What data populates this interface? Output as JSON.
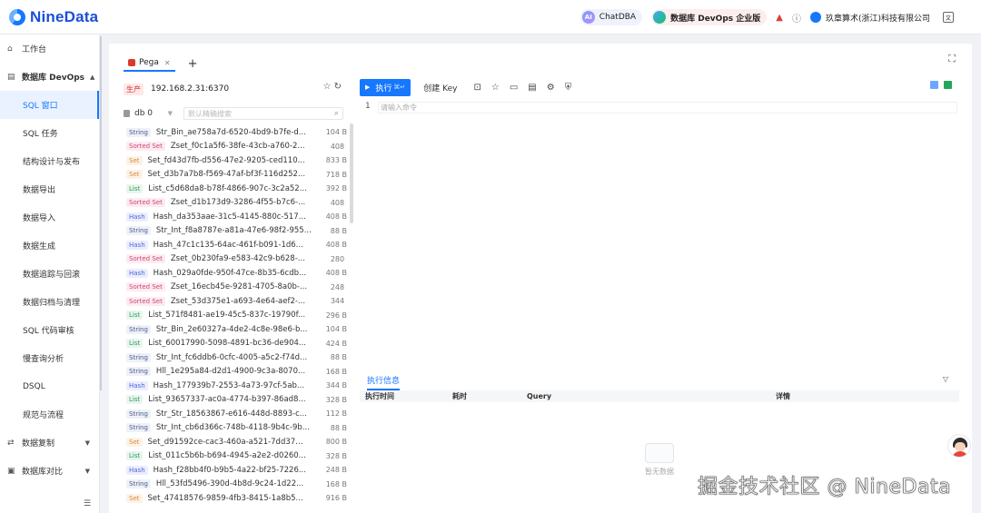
{
  "app": {
    "logo": "NineData"
  },
  "header": {
    "chat_label": "ChatDBA",
    "chat_icon_text": "AI",
    "edition_label": "数据库 DevOps 企业版",
    "company": "玖章算术(浙江)科技有限公司"
  },
  "sidebar": {
    "workbench": "工作台",
    "group_devops": "数据库 DevOps",
    "items": [
      "SQL 窗口",
      "SQL 任务",
      "结构设计与发布",
      "数据导出",
      "数据导入",
      "数据生成",
      "数据追踪与回滚",
      "数据归档与清理",
      "SQL 代码审核",
      "慢查询分析",
      "DSQL",
      "规范与流程"
    ],
    "group_replication": "数据复制",
    "group_compare": "数据库对比"
  },
  "tabs": [
    {
      "label": "Pega"
    }
  ],
  "connection": {
    "env": "生产",
    "address": "192.168.2.31:6370"
  },
  "db_select": {
    "value": "db 0"
  },
  "search": {
    "placeholder": "默认精确搜索"
  },
  "keys": [
    {
      "type": "String",
      "name": "Str_Bin_ae758a7d-6520-4bd9-b7fe-d...",
      "size": "104 B"
    },
    {
      "type": "Sorted Set",
      "name": "Zset_f0c1a5f6-38fe-43cb-a760-2...",
      "size": "408 B"
    },
    {
      "type": "Set",
      "name": "Set_fd43d7fb-d556-47e2-9205-ced110...",
      "size": "833 B"
    },
    {
      "type": "Set",
      "name": "Set_d3b7a7b8-f569-47af-bf3f-116d252...",
      "size": "718 B"
    },
    {
      "type": "List",
      "name": "List_c5d68da8-b78f-4866-907c-3c2a52...",
      "size": "392 B"
    },
    {
      "type": "Sorted Set",
      "name": "Zset_d1b173d9-3286-4f55-b7c6-...",
      "size": "408 B"
    },
    {
      "type": "Hash",
      "name": "Hash_da353aae-31c5-4145-880c-517...",
      "size": "408 B"
    },
    {
      "type": "String",
      "name": "Str_Int_f8a8787e-a81a-47e6-98f2-955...",
      "size": "88 B"
    },
    {
      "type": "Hash",
      "name": "Hash_47c1c135-64ac-461f-b091-1d6...",
      "size": "408 B"
    },
    {
      "type": "Sorted Set",
      "name": "Zset_0b230fa9-e583-42c9-b628-...",
      "size": "280 B"
    },
    {
      "type": "Hash",
      "name": "Hash_029a0fde-950f-47ce-8b35-6cdb...",
      "size": "408 B"
    },
    {
      "type": "Sorted Set",
      "name": "Zset_16ecb45e-9281-4705-8a0b-...",
      "size": "248 B"
    },
    {
      "type": "Sorted Set",
      "name": "Zset_53d375e1-a693-4e64-aef2-...",
      "size": "344 B"
    },
    {
      "type": "List",
      "name": "List_571f8481-ae19-45c5-837c-19790f...",
      "size": "296 B"
    },
    {
      "type": "String",
      "name": "Str_Bin_2e60327a-4de2-4c8e-98e6-b...",
      "size": "104 B"
    },
    {
      "type": "List",
      "name": "List_60017990-5098-4891-bc36-de904...",
      "size": "424 B"
    },
    {
      "type": "String",
      "name": "Str_Int_fc6ddb6-0cfc-4005-a5c2-f74d...",
      "size": "88 B"
    },
    {
      "type": "String",
      "name": "Hll_1e295a84-d2d1-4900-9c3a-8070...",
      "size": "168 B"
    },
    {
      "type": "Hash",
      "name": "Hash_177939b7-2553-4a73-97cf-5ab...",
      "size": "344 B"
    },
    {
      "type": "List",
      "name": "List_93657337-ac0a-4774-b397-86ad8...",
      "size": "328 B"
    },
    {
      "type": "String",
      "name": "Str_Str_18563867-e616-448d-8893-c...",
      "size": "112 B"
    },
    {
      "type": "String",
      "name": "Str_Int_cb6d366c-748b-4118-9b4c-9b...",
      "size": "88 B"
    },
    {
      "type": "Set",
      "name": "Set_d91592ce-cac3-460a-a521-7dd372...",
      "size": "800 B"
    },
    {
      "type": "List",
      "name": "List_011c5b6b-b694-4945-a2e2-d0260...",
      "size": "328 B"
    },
    {
      "type": "Hash",
      "name": "Hash_f28bb4f0-b9b5-4a22-bf25-7226...",
      "size": "248 B"
    },
    {
      "type": "String",
      "name": "Hll_53fd5496-390d-4b8d-9c24-1d22...",
      "size": "168 B"
    },
    {
      "type": "Set",
      "name": "Set_47418576-9859-4fb3-8415-1a8b5...",
      "size": "916 B"
    }
  ],
  "toolbar": {
    "run_label": "执行",
    "run_shortcut": "⌘↵",
    "create_key": "创建 Key"
  },
  "editor": {
    "line_number": "1",
    "placeholder": "请输入命令"
  },
  "exec": {
    "tab_label": "执行信息",
    "columns": [
      "执行时间",
      "耗时",
      "Query",
      "详情"
    ],
    "empty_text": "暂无数据"
  },
  "watermark": "掘金技术社区 @ NineData",
  "colors": {
    "primary": "#1677ff",
    "prod_badge": "#d9363e"
  }
}
